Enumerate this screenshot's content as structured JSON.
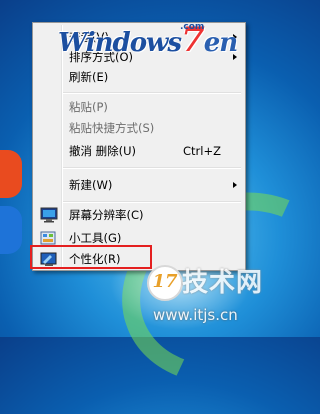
{
  "watermark": {
    "windows": "Windows",
    "seven": "7",
    "en": "en",
    "com": ".com"
  },
  "menu": {
    "items": [
      {
        "label": "查看(V)",
        "submenu": true
      },
      {
        "label": "排序方式(O)",
        "submenu": true
      },
      {
        "label": "刷新(E)"
      },
      {
        "label": "粘贴(P)",
        "disabled": true
      },
      {
        "label": "粘贴快捷方式(S)",
        "disabled": true
      },
      {
        "label": "撤消 删除(U)",
        "shortcut": "Ctrl+Z"
      },
      {
        "label": "新建(W)",
        "submenu": true
      },
      {
        "label": "屏幕分辨率(C)",
        "icon": "screen-resolution-icon"
      },
      {
        "label": "小工具(G)",
        "icon": "gadgets-icon"
      },
      {
        "label": "个性化(R)",
        "icon": "personalize-icon"
      }
    ]
  },
  "site_logo": {
    "badge": "17",
    "name": "技术网",
    "url": "www.itjs.cn"
  },
  "colors": {
    "highlight": "#e41f1f",
    "menu_bg": "#f0f0f0"
  }
}
